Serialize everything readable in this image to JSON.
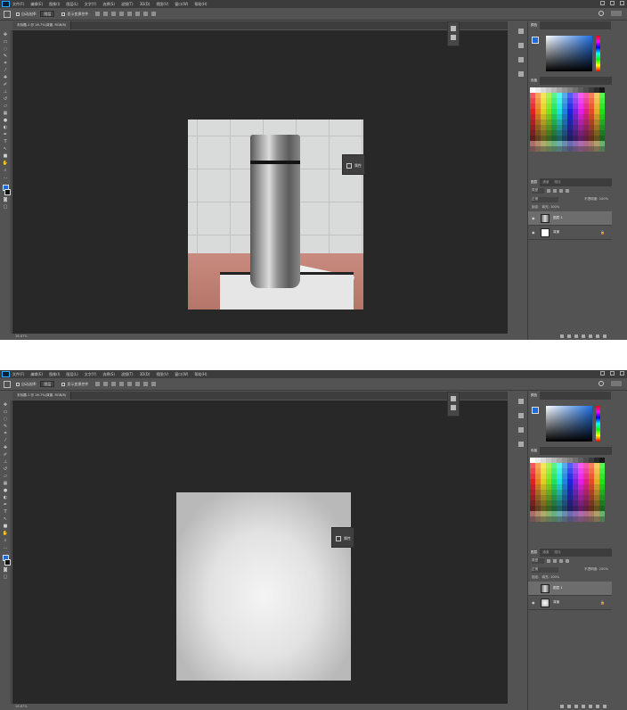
{
  "menubar": {
    "items": [
      "文件(F)",
      "编辑(E)",
      "图像(I)",
      "图层(L)",
      "文字(Y)",
      "选择(S)",
      "滤镜(T)",
      "3D(D)",
      "视图(V)",
      "窗口(W)",
      "帮助(H)"
    ]
  },
  "options_bar": {
    "auto_select_label": "自动选择:",
    "auto_select_value": "图层",
    "transform_label": "显示变换控件"
  },
  "screens": [
    {
      "document_tab": "未标题-1 @ 16.7%(背景, RGB/8)",
      "status": "16.67%",
      "mini_panel_label": "属性",
      "layers": [
        {
          "name": "图层 1",
          "thumb": "flask",
          "selected": true
        },
        {
          "name": "背景",
          "thumb": "white",
          "selected": false
        }
      ]
    },
    {
      "document_tab": "未标题-1 @ 16.7%(背景, RGB/8)",
      "status": "16.67%",
      "mini_panel_label": "属性",
      "layers": [
        {
          "name": "图层 1",
          "thumb": "flask",
          "selected": true
        },
        {
          "name": "背景",
          "thumb": "gradient",
          "selected": false
        }
      ]
    }
  ],
  "panels": {
    "color_tabs": [
      "颜色"
    ],
    "swatches_tabs": [
      "色板"
    ],
    "layers_tabs": [
      "图层",
      "通道",
      "路径"
    ],
    "layers_kind": "类型",
    "blend_mode": "正常",
    "opacity_label": "不透明度: 100%",
    "lock_label": "锁定:",
    "fill_label": "填充: 100%"
  },
  "colors": {
    "foreground": "#1e6bd6",
    "background": "#111111",
    "canvas": "#282828",
    "chrome": "#535353"
  }
}
